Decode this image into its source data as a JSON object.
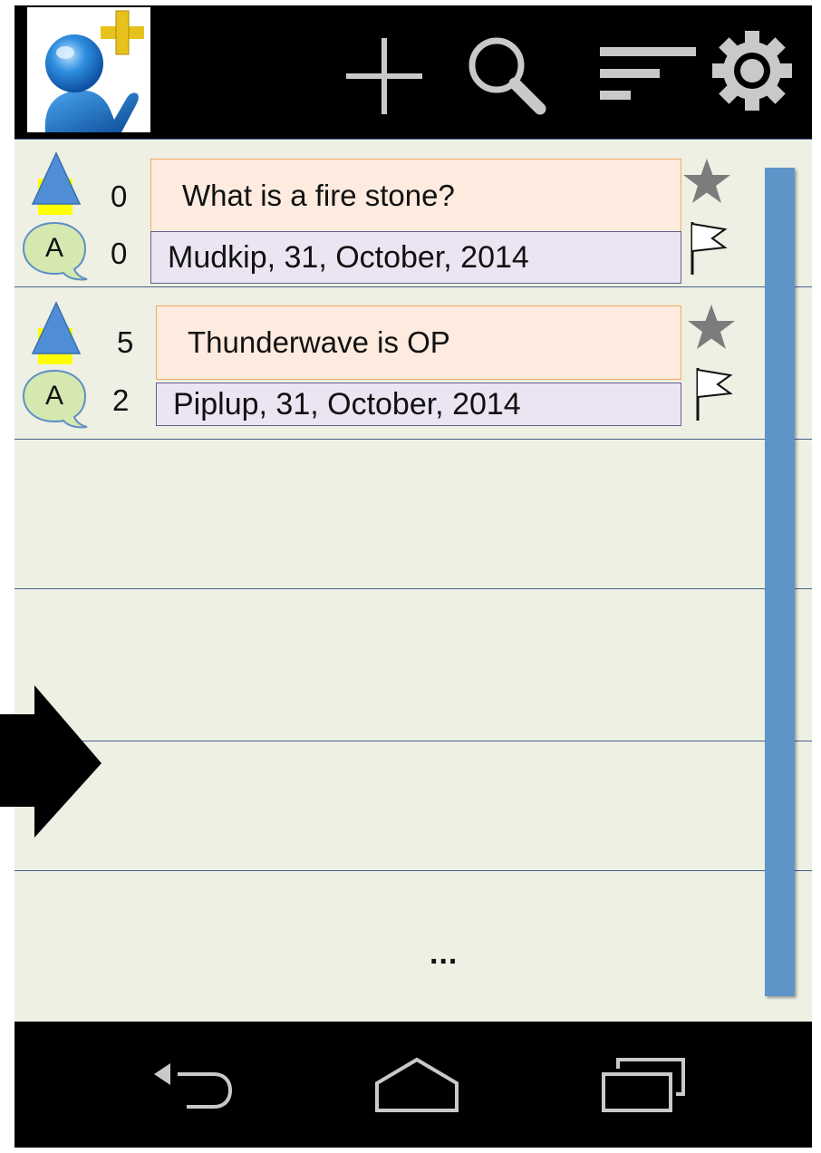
{
  "toolbar": {
    "icons": [
      "app-logo-person-plus",
      "add-icon",
      "search-icon",
      "sort-icon",
      "settings-icon"
    ]
  },
  "questions": [
    {
      "title": "What is a fire stone?",
      "votes": "0",
      "answers": "0",
      "meta": "Mudkip, 31, October, 2014",
      "answer_badge": "A"
    },
    {
      "title": "Thunderwave is OP",
      "votes": "5",
      "answers": "2",
      "meta": "Piplup, 31, October, 2014",
      "answer_badge": "A"
    }
  ],
  "list": {
    "more_indicator": "..."
  },
  "navbar": {
    "icons": [
      "back-icon",
      "home-icon",
      "recents-icon"
    ]
  },
  "colors": {
    "background": "#edf0e3",
    "title_fill": "#fdebdf",
    "title_border": "#f4a95e",
    "meta_fill": "#ebe5f3",
    "meta_border": "#6a5e8e",
    "scrollbar": "#5f94c8",
    "vote_arrow": "#4f8ed6",
    "vote_highlight": "#ffff00",
    "bubble": "#d4e8b0"
  }
}
